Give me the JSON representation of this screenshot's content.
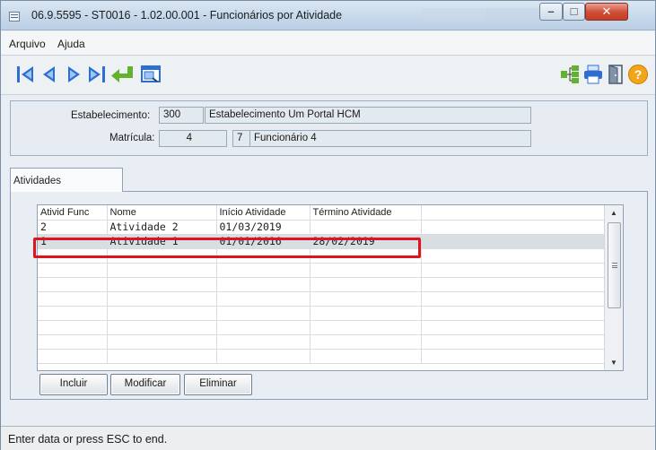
{
  "window": {
    "title": "06.9.5595 - ST0016 - 1.02.00.001 - Funcionários por Atividade"
  },
  "menu": {
    "items": [
      {
        "label": "Arquivo"
      },
      {
        "label": "Ajuda"
      }
    ]
  },
  "toolbar": {
    "left_icons": [
      "first-record-icon",
      "previous-record-icon",
      "next-record-icon",
      "last-record-icon",
      "goto-enter-icon",
      "search-window-icon"
    ],
    "right_icons": [
      "tree-structure-icon",
      "printer-icon",
      "exit-door-icon",
      "help-icon"
    ]
  },
  "header": {
    "estabelecimento_label": "Estabelecimento:",
    "estabelecimento_code": "300",
    "estabelecimento_name": "Estabelecimento Um Portal HCM",
    "matricula_label": "Matrícula:",
    "matricula_value": "4",
    "matricula_digit": "7",
    "funcionario_name": "Funcionário 4"
  },
  "tabs": {
    "active_label": "Atividades"
  },
  "grid": {
    "columns": [
      "Ativid Func",
      "Nome",
      "Início Atividade",
      "Término Atividade",
      ""
    ],
    "rows": [
      [
        "2",
        "Atividade 2",
        "01/03/2019",
        "",
        ""
      ],
      [
        "1",
        "Atividade 1",
        "01/01/2016",
        "28/02/2019",
        ""
      ]
    ],
    "selected_row_index": 1
  },
  "buttons": {
    "incluir": "Incluir",
    "modificar": "Modificar",
    "eliminar": "Eliminar"
  },
  "status": {
    "text": "Enter data or press ESC to end."
  },
  "colors": {
    "highlight": "#e0141c",
    "toolbar_nav_blue": "#2d6fd1",
    "enter_green": "#63b22f",
    "help_orange": "#f2a518"
  }
}
